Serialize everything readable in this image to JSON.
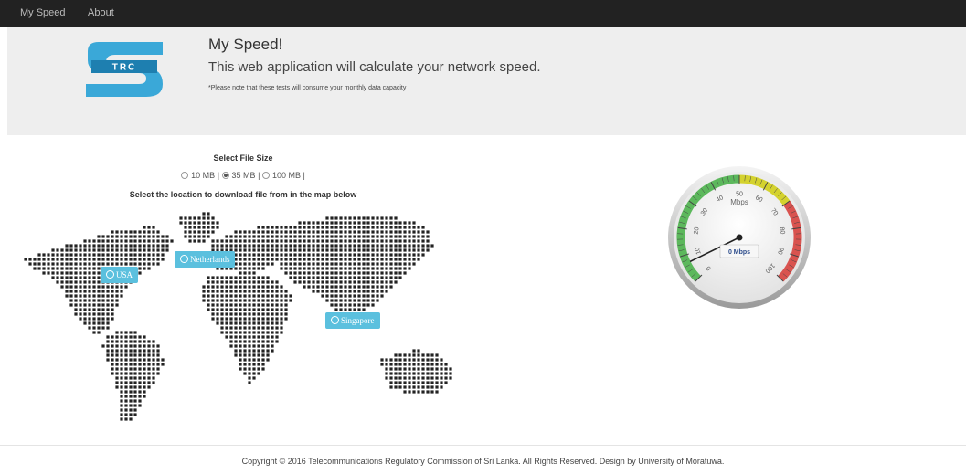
{
  "nav": {
    "items": [
      {
        "label": "My Speed"
      },
      {
        "label": "About"
      }
    ]
  },
  "hero": {
    "logo_text": "TRC",
    "title": "My Speed!",
    "subtitle": "This web application will calculate your network speed.",
    "note": "*Please note that these tests will consume your monthly data capacity"
  },
  "file_size": {
    "title": "Select File Size",
    "options": [
      {
        "label": "10 MB",
        "selected": false
      },
      {
        "label": "35 MB",
        "selected": true
      },
      {
        "label": "100 MB",
        "selected": false
      }
    ],
    "separator": "|"
  },
  "map": {
    "instruction": "Select the location to download file from in the map below",
    "locations": [
      {
        "label": "USA"
      },
      {
        "label": "Netherlands"
      },
      {
        "label": "Singapore"
      }
    ],
    "dot_color": "#222222",
    "pin_color": "#5bc0de"
  },
  "gauge": {
    "unit_label": "Mbps",
    "readout": "0 Mbps",
    "min": 0,
    "max": 100,
    "value": 0,
    "ticks": [
      "0",
      "10",
      "20",
      "30",
      "40",
      "50",
      "60",
      "70",
      "80",
      "90",
      "100"
    ],
    "bands": [
      {
        "from": 0,
        "to": 50,
        "color": "#5cb85c"
      },
      {
        "from": 50,
        "to": 70,
        "color": "#d4d22e"
      },
      {
        "from": 70,
        "to": 100,
        "color": "#d9534f"
      }
    ]
  },
  "footer": {
    "text": "Copyright © 2016 Telecommunications Regulatory Commission of Sri Lanka. All Rights Reserved. Design by University of Moratuwa."
  }
}
